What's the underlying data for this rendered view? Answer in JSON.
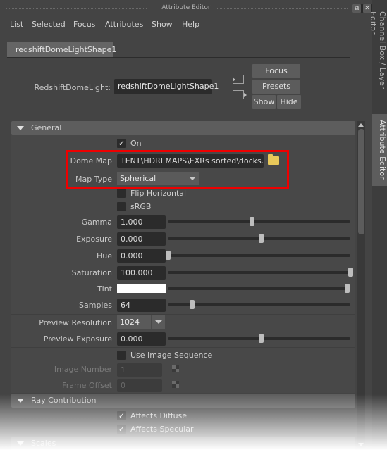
{
  "window": {
    "title": "Attribute Editor",
    "float_icon": "float-window-icon",
    "close_icon": "close-icon"
  },
  "menu": [
    "List",
    "Selected",
    "Focus",
    "Attributes",
    "Show",
    "Help"
  ],
  "tabs": [
    {
      "label": "redshiftDomeLightShape1",
      "active": true
    }
  ],
  "node": {
    "type_label": "RedshiftDomeLight:",
    "name": "redshiftDomeLightShape1",
    "input_icon": "input-connections-icon",
    "output_icon": "output-connections-icon",
    "buttons": {
      "focus": "Focus",
      "presets": "Presets",
      "show": "Show",
      "hide": "Hide"
    }
  },
  "side_tabs": [
    "Channel Box / Layer Editor",
    "Attribute Editor"
  ],
  "sections": {
    "general": {
      "title": "General",
      "on": {
        "label": "On",
        "checked": true
      },
      "dome_map": {
        "label": "Dome Map",
        "value": "TENT\\HDRI MAPS\\EXRs sorted\\docks.exr",
        "icon": "folder-icon"
      },
      "map_type": {
        "label": "Map Type",
        "value": "Spherical"
      },
      "flip_horizontal": {
        "label": "Flip Horizontal",
        "checked": false
      },
      "srgb": {
        "label": "sRGB",
        "checked": false
      },
      "gamma": {
        "label": "Gamma",
        "value": "1.000",
        "slider": 0.46
      },
      "exposure": {
        "label": "Exposure",
        "value": "0.000",
        "slider": 0.51
      },
      "hue": {
        "label": "Hue",
        "value": "0.000",
        "slider": 0.0
      },
      "saturation": {
        "label": "Saturation",
        "value": "100.000",
        "slider": 1.0
      },
      "tint": {
        "label": "Tint",
        "color": "#ffffff",
        "slider": 0.98
      },
      "samples": {
        "label": "Samples",
        "value": "64",
        "slider": 0.13
      },
      "preview_resolution": {
        "label": "Preview Resolution",
        "value": "1024"
      },
      "preview_exposure": {
        "label": "Preview Exposure",
        "value": "0.000",
        "slider": 0.51
      },
      "use_image_sequence": {
        "label": "Use Image Sequence",
        "checked": false
      },
      "image_number": {
        "label": "Image Number",
        "value": "1"
      },
      "frame_offset": {
        "label": "Frame Offset",
        "value": "0"
      }
    },
    "ray_contribution": {
      "title": "Ray Contribution",
      "affects_diffuse": {
        "label": "Affects Diffuse",
        "checked": true
      },
      "affects_specular": {
        "label": "Affects Specular",
        "checked": true
      }
    },
    "scales": {
      "title": "Scales"
    }
  },
  "colors": {
    "highlight": "#ee0000",
    "panel": "#444444",
    "field": "#2b2b2b"
  }
}
